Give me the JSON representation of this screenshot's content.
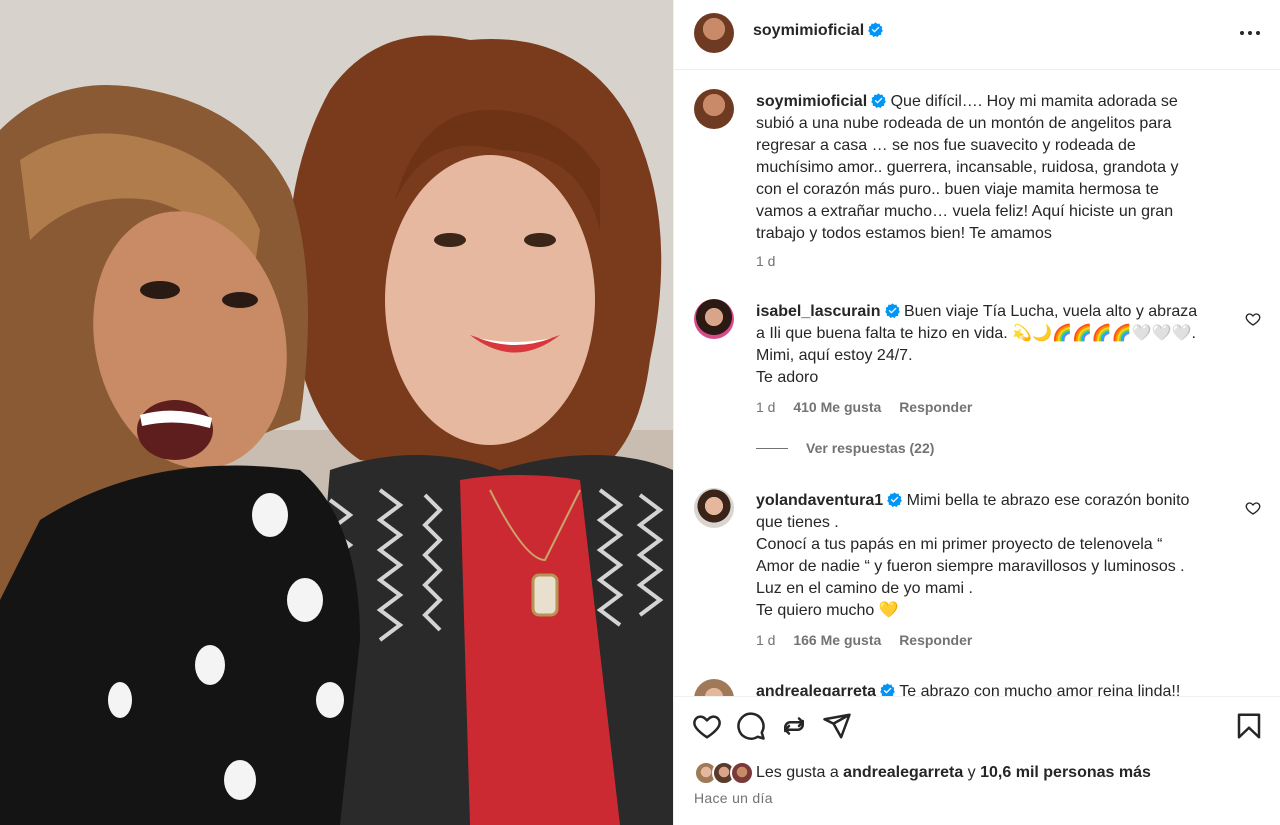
{
  "post": {
    "username": "soymimioficial",
    "more_label": "Más opciones",
    "caption": {
      "username": "soymimioficial",
      "lines": [
        "Que difícil…. Hoy mi mamita adorada se",
        "subió a una nube rodeada de un montón de angelitos para",
        "regresar a casa … se nos fue suavecito y rodeada de",
        "muchísimo amor.. guerrera, incansable, ruidosa, grandota y",
        "con el corazón más puro.. buen viaje mamita hermosa te",
        "vamos a extrañar mucho… vuela feliz! Aquí hiciste un gran",
        "trabajo y todos estamos bien! Te amamos"
      ],
      "age": "1 d"
    },
    "comments": [
      {
        "username": "isabel_lascurain",
        "lines": [
          "Buen viaje Tía Lucha, vuela alto y abraza",
          "a Ili que buena falta te hizo en vida. 💫🌙🌈🌈🌈🌈🤍🤍🤍.",
          "Mimi, aquí estoy 24/7.",
          "Te adoro"
        ],
        "age": "1 d",
        "likes": "410 Me gusta",
        "reply": "Responder",
        "view_replies": "Ver respuestas (22)"
      },
      {
        "username": "yolandaventura1",
        "lines": [
          "Mimi bella te abrazo ese corazón bonito",
          "que tienes .",
          "Conocí a tus papás en mi primer proyecto de telenovela “",
          "Amor de nadie “ y fueron siempre maravillosos y luminosos .",
          "Luz en el camino de yo mami .",
          "Te quiero mucho 💛"
        ],
        "age": "1 d",
        "likes": "166 Me gusta",
        "reply": "Responder"
      },
      {
        "username": "andrealegarreta",
        "lines": [
          "Te abrazo con mucho amor reina linda!!"
        ]
      }
    ],
    "likes_summary": {
      "prefix": "Les gusta a ",
      "user": "andrealegarreta",
      "middle": " y ",
      "count": "10,6 mil personas más"
    },
    "posted": "Hace un día"
  },
  "colors": {
    "verified": "#0095f6",
    "secondary_text": "#737373",
    "border": "#efefef"
  },
  "icons": [
    "more-icon",
    "verified-icon",
    "heart-icon",
    "comment-icon",
    "share-icon",
    "send-icon",
    "bookmark-icon"
  ]
}
